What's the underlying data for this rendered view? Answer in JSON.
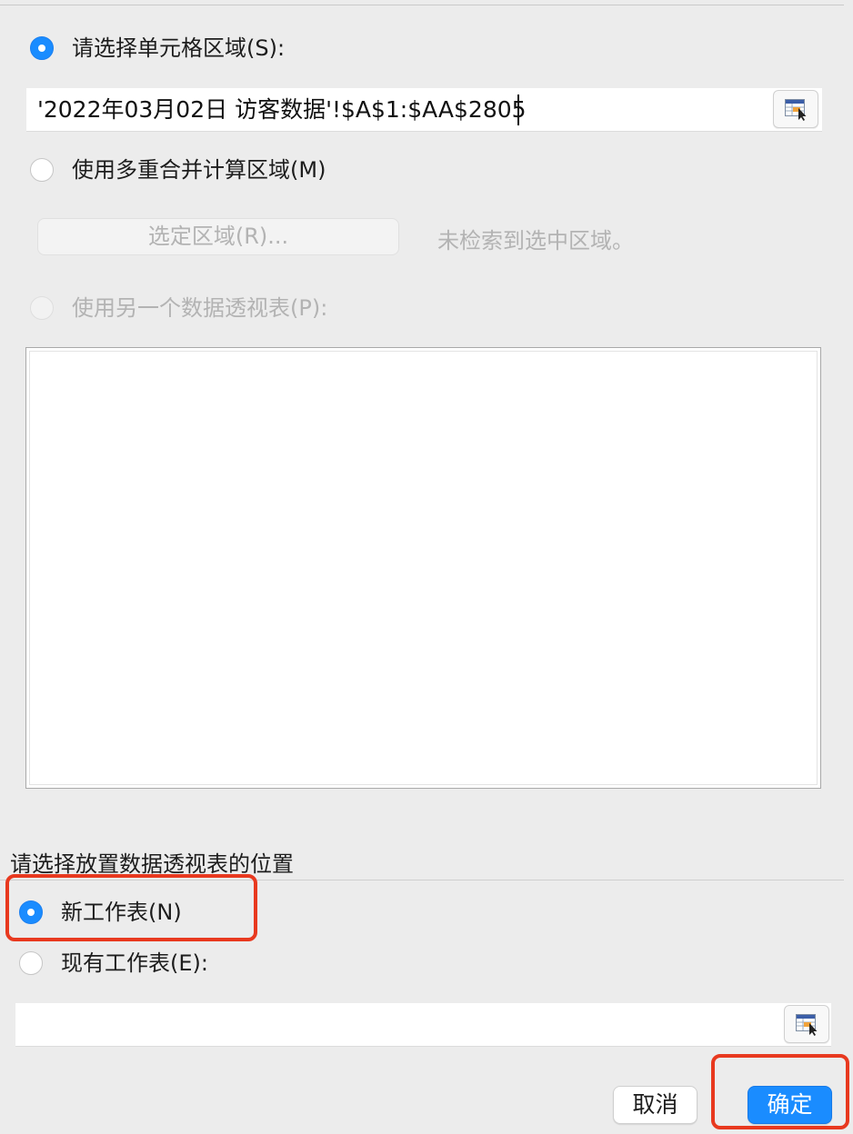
{
  "source": {
    "option_range_label": "请选择单元格区域(S):",
    "range_value": "'2022年03月02日 访客数据'!$A$1:$AA$2805",
    "option_multi_label": "使用多重合并计算区域(M)",
    "select_region_button": "选定区域(R)...",
    "no_region_text": "未检索到选中区域。",
    "option_other_pivot_label": "使用另一个数据透视表(P):"
  },
  "placement": {
    "heading": "请选择放置数据透视表的位置",
    "option_new_sheet_label": "新工作表(N)",
    "option_existing_sheet_label": "现有工作表(E):",
    "existing_value": ""
  },
  "buttons": {
    "cancel": "取消",
    "ok": "确定"
  },
  "colors": {
    "accent": "#1a8cff",
    "highlight_annotation": "#e8391f"
  },
  "icons": {
    "range_picker": "range-picker-icon"
  }
}
